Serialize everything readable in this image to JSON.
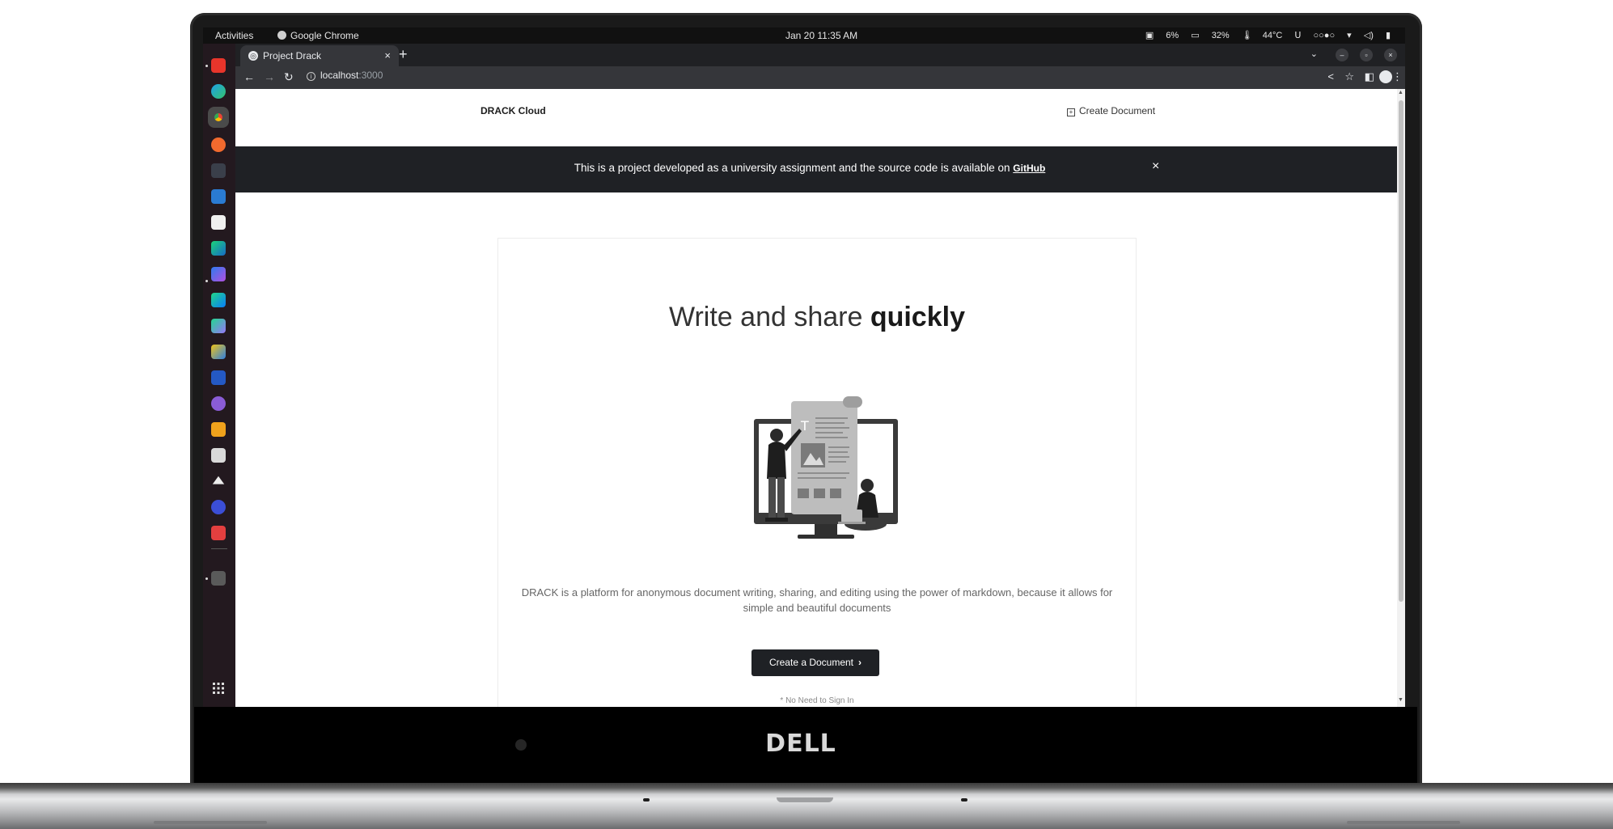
{
  "os": {
    "activities": "Activities",
    "app_name": "Google Chrome",
    "clock": "Jan 20  11:35 AM",
    "status": {
      "disk": "6%",
      "memory": "32%",
      "temperature": "44°C"
    }
  },
  "browser": {
    "tab_title": "Project Drack",
    "url_host": "localhost",
    "url_port": ":3000"
  },
  "site": {
    "brand": "DRACK Cloud",
    "header_action": "Create Document",
    "banner_text": "This is a project developed as a university assignment and the source code is available on ",
    "banner_link": "GitHub",
    "hero_title_light": "Write and share ",
    "hero_title_bold": "quickly",
    "hero_description": "DRACK is a platform for anonymous document writing, sharing, and editing using the power of markdown, because it allows for simple and beautiful documents",
    "cta_label": "Create a Document",
    "note": "* No Need to Sign In"
  },
  "laptop": {
    "brand": "DELL"
  },
  "icons": {
    "tab_close": "×",
    "new_tab": "+",
    "banner_close": "×",
    "cta_chevron": "›",
    "apps_grid": "⋮⋮⋮"
  }
}
